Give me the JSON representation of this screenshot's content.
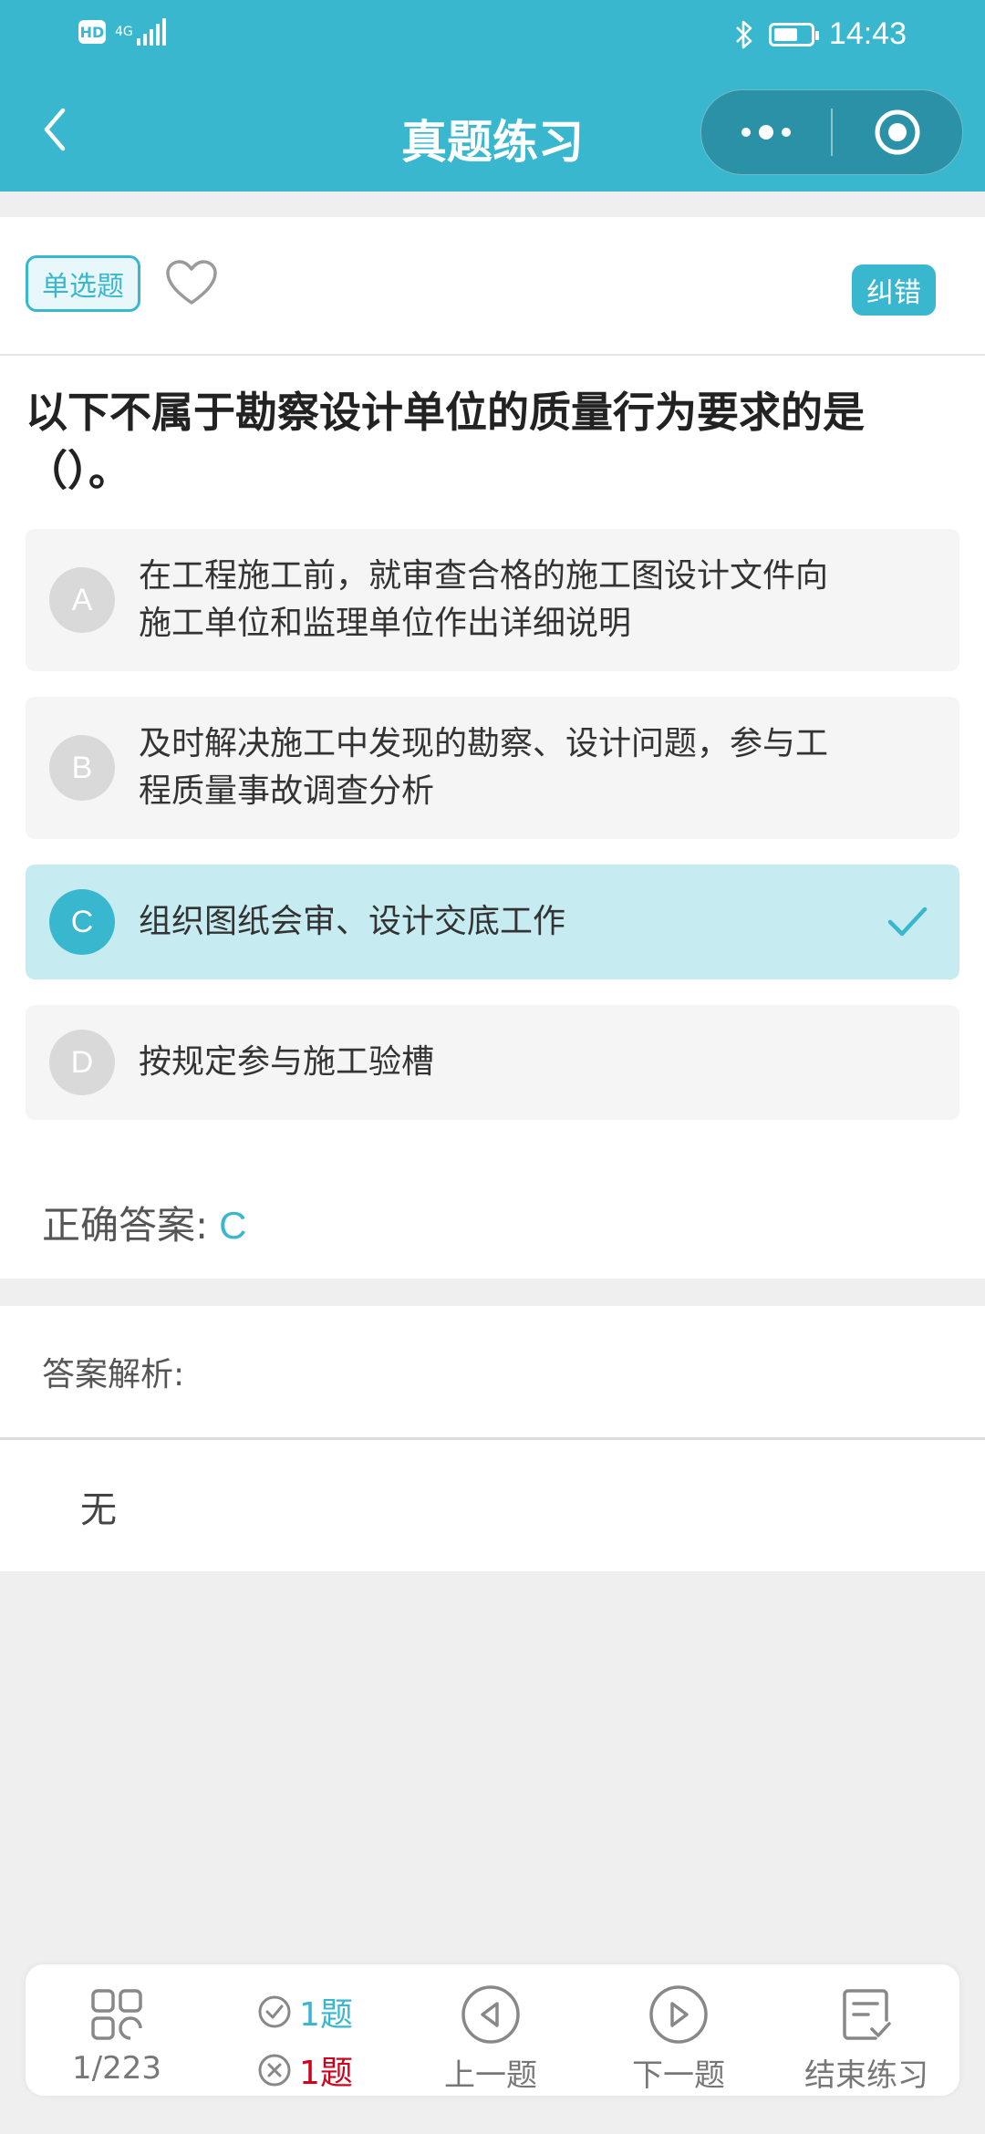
{
  "status_bar": {
    "hd": "HD",
    "network": "4G",
    "time": "14:43",
    "battery_level": 0.65
  },
  "nav": {
    "title": "真题练习"
  },
  "question": {
    "type_tag": "单选题",
    "fix_label": "纠错",
    "text": "以下不属于勘察设计单位的质量行为要求的是（）。",
    "options": [
      {
        "letter": "A",
        "text": "在工程施工前，就审查合格的施工图设计文件向施工单位和监理单位作出详细说明",
        "selected": false
      },
      {
        "letter": "B",
        "text": "及时解决施工中发现的勘察、设计问题，参与工程质量事故调查分析",
        "selected": false
      },
      {
        "letter": "C",
        "text": "组织图纸会审、设计交底工作",
        "selected": true
      },
      {
        "letter": "D",
        "text": "按规定参与施工验槽",
        "selected": false
      }
    ]
  },
  "answer": {
    "label": "正确答案:",
    "value": "C"
  },
  "analysis": {
    "label": "答案解析:",
    "text": "无"
  },
  "bottom_bar": {
    "progress": "1/223",
    "correct_count": "1题",
    "wrong_count": "1题",
    "prev_label": "上一题",
    "next_label": "下一题",
    "end_label": "结束练习"
  },
  "colors": {
    "accent": "#39b7cf",
    "selected_bg": "#c6ecf2",
    "wrong": "#d0021b"
  }
}
